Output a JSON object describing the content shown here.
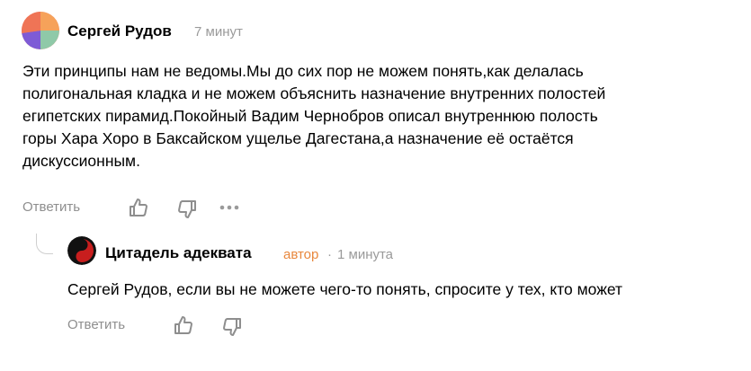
{
  "comment": {
    "author": "Сергей Рудов",
    "time": "7 минут",
    "text_lines": [
      "Эти принципы нам не ведомы.Мы до сих пор не можем понять,как делалась",
      "полигональная кладка и не можем объяснить назначение внутренних полостей",
      "египетских пирамид.Покойный Вадим Чернобров описал внутреннюю полость",
      "горы Хара Хоро в Баксайском ущелье Дагестана,а назначение её остаётся",
      "дискуссионным."
    ],
    "actions": {
      "reply_label": "Ответить",
      "like_icon": "thumbs-up-icon",
      "dislike_icon": "thumbs-down-icon",
      "more_icon": "more-dots-icon"
    }
  },
  "reply": {
    "author": "Цитадель адеквата",
    "badge": "автор",
    "separator": "·",
    "time": "1 минута",
    "text": "Сергей Рудов, если вы не можете чего-то понять, спросите у тех, кто может",
    "actions": {
      "reply_label": "Ответить",
      "like_icon": "thumbs-up-icon",
      "dislike_icon": "thumbs-down-icon"
    }
  },
  "colors": {
    "muted_text": "#9a9a9a",
    "author_badge": "#e8873d",
    "icon": "#8e8e8e"
  }
}
